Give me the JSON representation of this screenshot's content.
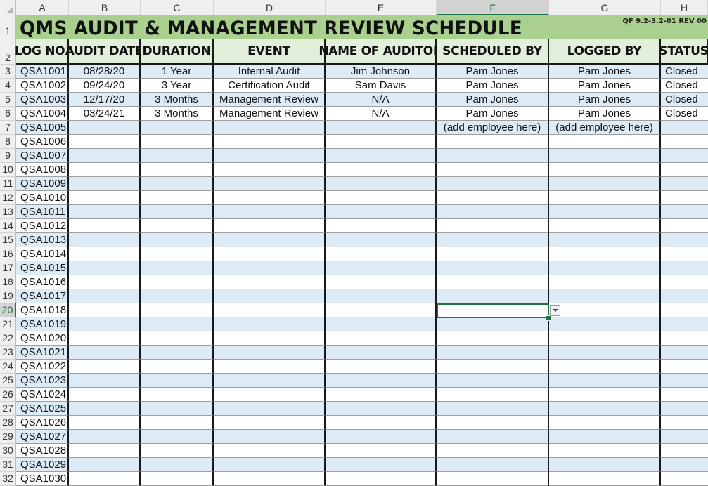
{
  "columns": [
    "A",
    "B",
    "C",
    "D",
    "E",
    "F",
    "G",
    "H"
  ],
  "selected_column": "F",
  "selected_row": "20",
  "title": "QMS AUDIT & MANAGEMENT REVIEW SCHEDULE",
  "form_code": "QF 9.2-3.2-01 REV 00",
  "title_row_number": "1",
  "header_row_number": "2",
  "headers": [
    "LOG NO.",
    "AUDIT DATE",
    "DURATION",
    "EVENT",
    "NAME OF AUDITOR",
    "SCHEDULED BY",
    "LOGGED BY",
    "STATUS"
  ],
  "rows": [
    {
      "num": "3",
      "log": "QSA1001",
      "date": "08/28/20",
      "duration": "1 Year",
      "event": "Internal Audit",
      "auditor": "Jim Johnson",
      "scheduled": "Pam Jones",
      "logged": "Pam Jones",
      "status": "Closed"
    },
    {
      "num": "4",
      "log": "QSA1002",
      "date": "09/24/20",
      "duration": "3 Year",
      "event": "Certification Audit",
      "auditor": "Sam Davis",
      "scheduled": "Pam Jones",
      "logged": "Pam Jones",
      "status": "Closed"
    },
    {
      "num": "5",
      "log": "QSA1003",
      "date": "12/17/20",
      "duration": "3 Months",
      "event": "Management Review",
      "auditor": "N/A",
      "scheduled": "Pam Jones",
      "logged": "Pam Jones",
      "status": "Closed"
    },
    {
      "num": "6",
      "log": "QSA1004",
      "date": "03/24/21",
      "duration": "3 Months",
      "event": "Management Review",
      "auditor": "N/A",
      "scheduled": "Pam Jones",
      "logged": "Pam Jones",
      "status": "Closed"
    },
    {
      "num": "7",
      "log": "QSA1005",
      "date": "",
      "duration": "",
      "event": "",
      "auditor": "",
      "scheduled": "(add employee here)",
      "logged": "(add employee here)",
      "status": ""
    },
    {
      "num": "8",
      "log": "QSA1006",
      "date": "",
      "duration": "",
      "event": "",
      "auditor": "",
      "scheduled": "",
      "logged": "",
      "status": ""
    },
    {
      "num": "9",
      "log": "QSA1007",
      "date": "",
      "duration": "",
      "event": "",
      "auditor": "",
      "scheduled": "",
      "logged": "",
      "status": ""
    },
    {
      "num": "10",
      "log": "QSA1008",
      "date": "",
      "duration": "",
      "event": "",
      "auditor": "",
      "scheduled": "",
      "logged": "",
      "status": ""
    },
    {
      "num": "11",
      "log": "QSA1009",
      "date": "",
      "duration": "",
      "event": "",
      "auditor": "",
      "scheduled": "",
      "logged": "",
      "status": ""
    },
    {
      "num": "12",
      "log": "QSA1010",
      "date": "",
      "duration": "",
      "event": "",
      "auditor": "",
      "scheduled": "",
      "logged": "",
      "status": ""
    },
    {
      "num": "13",
      "log": "QSA1011",
      "date": "",
      "duration": "",
      "event": "",
      "auditor": "",
      "scheduled": "",
      "logged": "",
      "status": ""
    },
    {
      "num": "14",
      "log": "QSA1012",
      "date": "",
      "duration": "",
      "event": "",
      "auditor": "",
      "scheduled": "",
      "logged": "",
      "status": ""
    },
    {
      "num": "15",
      "log": "QSA1013",
      "date": "",
      "duration": "",
      "event": "",
      "auditor": "",
      "scheduled": "",
      "logged": "",
      "status": ""
    },
    {
      "num": "16",
      "log": "QSA1014",
      "date": "",
      "duration": "",
      "event": "",
      "auditor": "",
      "scheduled": "",
      "logged": "",
      "status": ""
    },
    {
      "num": "17",
      "log": "QSA1015",
      "date": "",
      "duration": "",
      "event": "",
      "auditor": "",
      "scheduled": "",
      "logged": "",
      "status": ""
    },
    {
      "num": "18",
      "log": "QSA1016",
      "date": "",
      "duration": "",
      "event": "",
      "auditor": "",
      "scheduled": "",
      "logged": "",
      "status": ""
    },
    {
      "num": "19",
      "log": "QSA1017",
      "date": "",
      "duration": "",
      "event": "",
      "auditor": "",
      "scheduled": "",
      "logged": "",
      "status": ""
    },
    {
      "num": "20",
      "log": "QSA1018",
      "date": "",
      "duration": "",
      "event": "",
      "auditor": "",
      "scheduled": "",
      "logged": "",
      "status": ""
    },
    {
      "num": "21",
      "log": "QSA1019",
      "date": "",
      "duration": "",
      "event": "",
      "auditor": "",
      "scheduled": "",
      "logged": "",
      "status": ""
    },
    {
      "num": "22",
      "log": "QSA1020",
      "date": "",
      "duration": "",
      "event": "",
      "auditor": "",
      "scheduled": "",
      "logged": "",
      "status": ""
    },
    {
      "num": "23",
      "log": "QSA1021",
      "date": "",
      "duration": "",
      "event": "",
      "auditor": "",
      "scheduled": "",
      "logged": "",
      "status": ""
    },
    {
      "num": "24",
      "log": "QSA1022",
      "date": "",
      "duration": "",
      "event": "",
      "auditor": "",
      "scheduled": "",
      "logged": "",
      "status": ""
    },
    {
      "num": "25",
      "log": "QSA1023",
      "date": "",
      "duration": "",
      "event": "",
      "auditor": "",
      "scheduled": "",
      "logged": "",
      "status": ""
    },
    {
      "num": "26",
      "log": "QSA1024",
      "date": "",
      "duration": "",
      "event": "",
      "auditor": "",
      "scheduled": "",
      "logged": "",
      "status": ""
    },
    {
      "num": "27",
      "log": "QSA1025",
      "date": "",
      "duration": "",
      "event": "",
      "auditor": "",
      "scheduled": "",
      "logged": "",
      "status": ""
    },
    {
      "num": "28",
      "log": "QSA1026",
      "date": "",
      "duration": "",
      "event": "",
      "auditor": "",
      "scheduled": "",
      "logged": "",
      "status": ""
    },
    {
      "num": "29",
      "log": "QSA1027",
      "date": "",
      "duration": "",
      "event": "",
      "auditor": "",
      "scheduled": "",
      "logged": "",
      "status": ""
    },
    {
      "num": "30",
      "log": "QSA1028",
      "date": "",
      "duration": "",
      "event": "",
      "auditor": "",
      "scheduled": "",
      "logged": "",
      "status": ""
    },
    {
      "num": "31",
      "log": "QSA1029",
      "date": "",
      "duration": "",
      "event": "",
      "auditor": "",
      "scheduled": "",
      "logged": "",
      "status": ""
    },
    {
      "num": "32",
      "log": "QSA1030",
      "date": "",
      "duration": "",
      "event": "",
      "auditor": "",
      "scheduled": "",
      "logged": "",
      "status": ""
    }
  ],
  "colors": {
    "title_band": "#a9d08e",
    "header_fill": "#e2efda",
    "band_blue": "#ddebf7",
    "selection": "#217346"
  },
  "icons": {
    "dropdown": "chevron-down-icon"
  }
}
